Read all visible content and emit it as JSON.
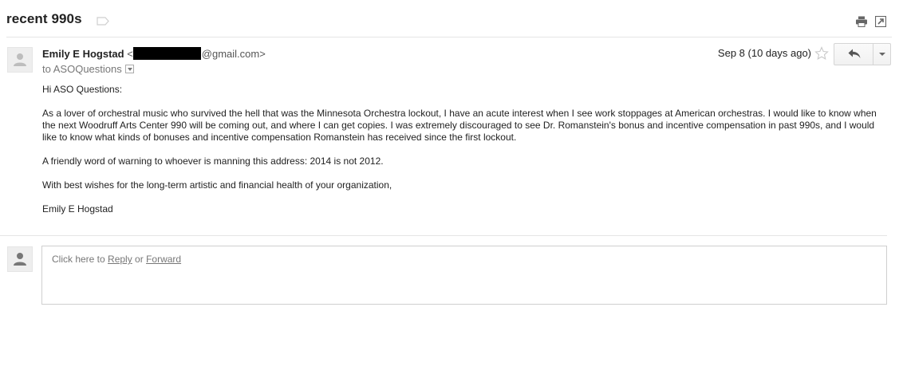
{
  "thread": {
    "subject": "recent 990s",
    "icons": {
      "label": "label-outline-icon",
      "print": "printer-icon",
      "new_window": "new-window-icon"
    }
  },
  "message": {
    "sender_name": "Emily E Hogstad",
    "sender_email_open": "<",
    "sender_email_domain": "@gmail.com>",
    "recipient_prefix": "to ",
    "recipient": "ASOQuestions",
    "date": "Sep 8 (10 days ago)",
    "body": {
      "greeting": "Hi ASO Questions:",
      "paragraph1": "As a lover of orchestral music who survived the hell that was the Minnesota Orchestra lockout, I have an acute interest when I see work stoppages at American orchestras. I would like to know when the next Woodruff Arts Center 990 will be coming out, and where I can get copies. I was extremely discouraged to see Dr. Romanstein's bonus and incentive compensation in past 990s, and I would like to know what kinds of bonuses and incentive compensation Romanstein has received since the first lockout.",
      "paragraph2": "A friendly word of warning to whoever is manning this address: 2014 is not 2012.",
      "paragraph3": "With best wishes for the long-term artistic and financial health of your organization,",
      "signature": "Emily E Hogstad"
    }
  },
  "reply": {
    "prompt_prefix": "Click here to ",
    "reply_link": "Reply",
    "or_text": " or ",
    "forward_link": "Forward"
  },
  "colors": {
    "border": "#e5e5e5",
    "avatar_bg": "#eeeeee",
    "text": "#222222",
    "muted": "#777777"
  }
}
